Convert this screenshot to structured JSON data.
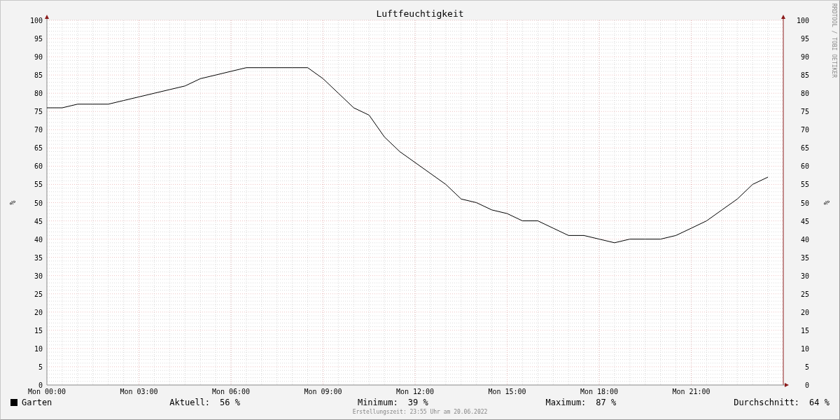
{
  "chart": {
    "chart_data": {
      "type": "line",
      "title": "Luftfeuchtigkeit",
      "ylabel": "%",
      "categories": [
        "Mon 00:00",
        null,
        null,
        null,
        null,
        null,
        "Mon 03:00",
        null,
        null,
        null,
        null,
        null,
        "Mon 06:00",
        null,
        null,
        null,
        null,
        null,
        "Mon 09:00",
        null,
        null,
        null,
        null,
        null,
        "Mon 12:00",
        null,
        null,
        null,
        null,
        null,
        "Mon 15:00",
        null,
        null,
        null,
        null,
        null,
        "Mon 18:00",
        null,
        null,
        null,
        null,
        null,
        "Mon 21:00",
        null,
        null,
        null,
        null,
        null
      ],
      "series": [
        {
          "name": "Garten",
          "color": "#000000",
          "values": [
            76,
            76,
            77,
            77,
            77,
            78,
            79,
            80,
            81,
            82,
            84,
            85,
            86,
            87,
            87,
            87,
            87,
            87,
            84,
            80,
            76,
            74,
            68,
            64,
            61,
            58,
            55,
            51,
            50,
            48,
            47,
            45,
            45,
            43,
            41,
            41,
            40,
            39,
            40,
            40,
            40,
            41,
            43,
            45,
            48,
            51,
            55,
            57
          ]
        }
      ],
      "ylim": [
        0,
        100
      ],
      "grid": true,
      "yticks": [
        0,
        5,
        10,
        15,
        20,
        25,
        30,
        35,
        40,
        45,
        50,
        55,
        60,
        65,
        70,
        75,
        80,
        85,
        90,
        95,
        100
      ]
    },
    "right_ylabel": "%",
    "right_yticks": [
      "100",
      "95",
      "90",
      "85",
      "80",
      "75",
      "70",
      "65",
      "60",
      "55",
      "50",
      "45",
      "40",
      "35",
      "30",
      "25",
      "20",
      "15",
      "10",
      "5",
      "0"
    ],
    "credit": "RRDTOOL / TOBI OETIKER"
  },
  "legend": {
    "stats": [
      {
        "label": "Aktuell:",
        "value": "56 %"
      },
      {
        "label": "Minimum:",
        "value": "39 %"
      },
      {
        "label": "Maximum:",
        "value": "87 %"
      },
      {
        "label": "Durchschnitt:",
        "value": "64 %"
      }
    ]
  },
  "footer": "Erstellungszeit: 23:55 Uhr am 20.06.2022"
}
